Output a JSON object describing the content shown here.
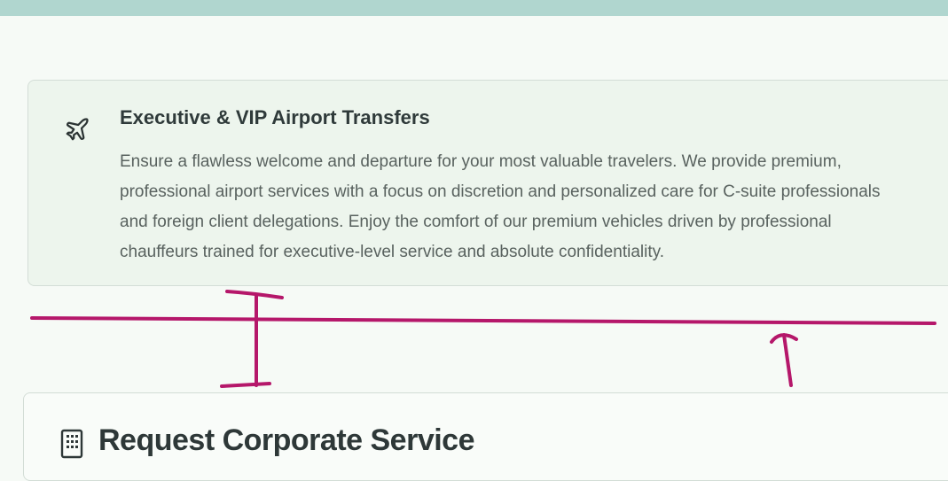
{
  "service": {
    "icon": "airplane-icon",
    "title": "Executive & VIP Airport Transfers",
    "description_lines": [
      "Ensure a flawless welcome and departure for your most valuable travelers. We provide premium,",
      "professional airport services with a focus on discretion and personalized care for C-suite professionals",
      "and foreign client delegations. Enjoy the comfort of our premium vehicles driven by professional",
      "chauffeurs trained for executive-level service and absolute confidentiality."
    ]
  },
  "request": {
    "icon": "building-icon",
    "title": "Request Corporate Service"
  },
  "colors": {
    "top_bar": "#b0d6cf",
    "annotation": "#b5176a",
    "page_bg": "#f6faf6",
    "card_bg": "#edf5ed"
  }
}
